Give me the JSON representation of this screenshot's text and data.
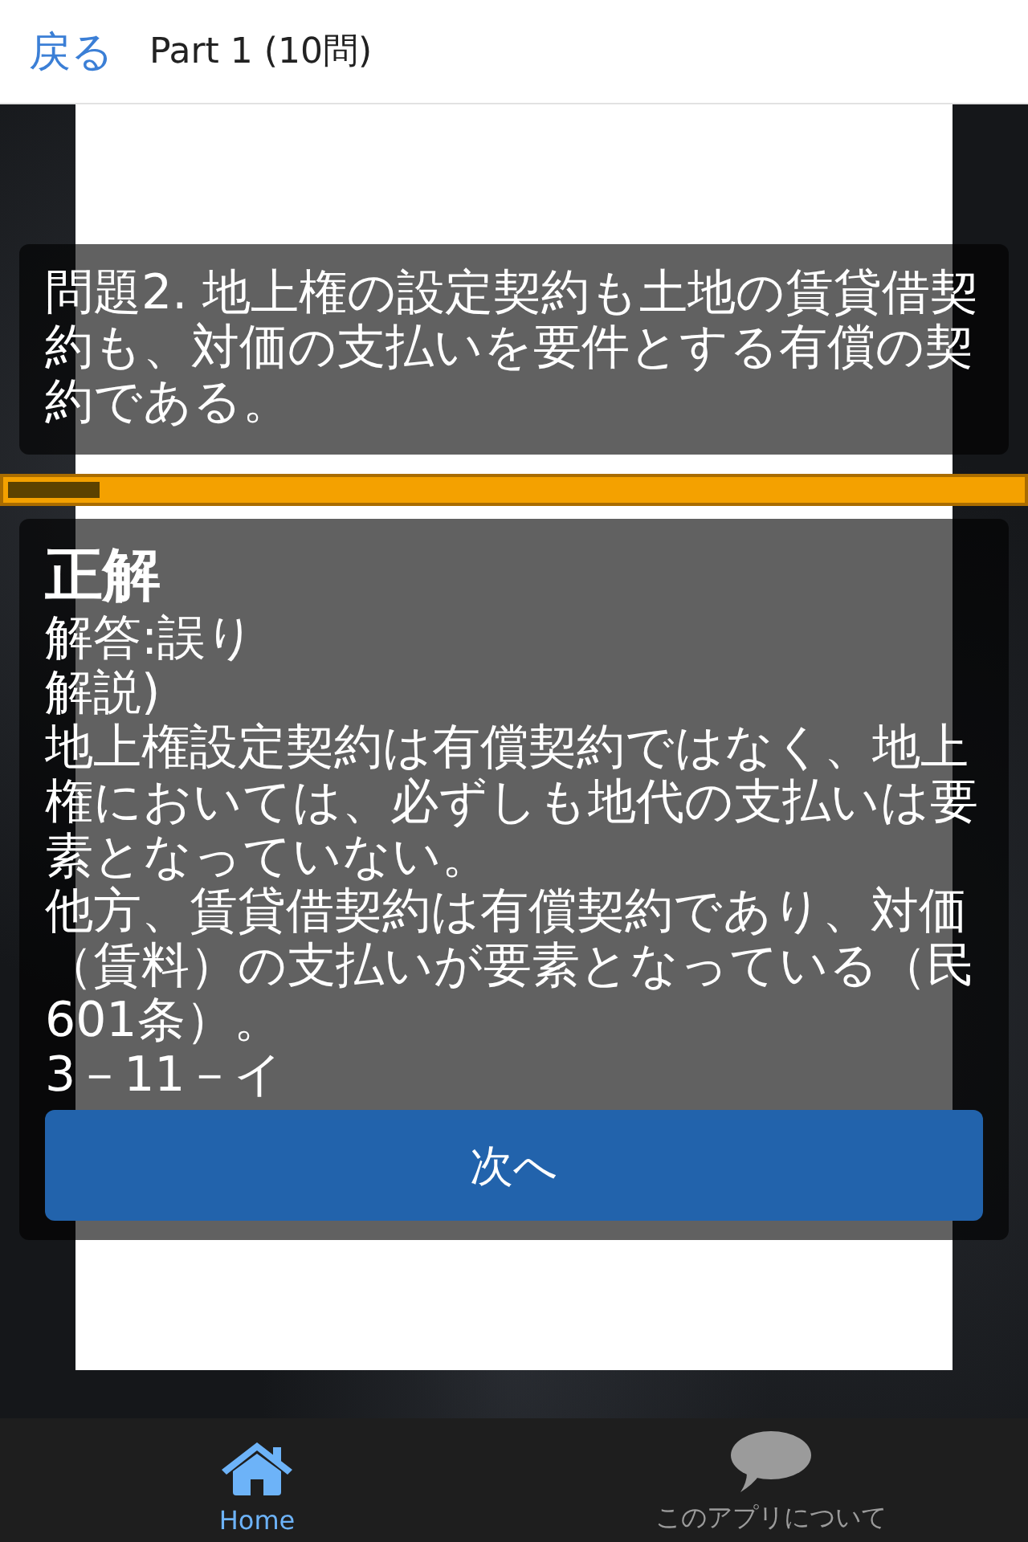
{
  "header": {
    "back_link": "戻る",
    "title": "Part 1 (10問)"
  },
  "question": {
    "text": "問題2. 地上権の設定契約も土地の賃貸借契約も、対価の支払いを要件とする有償の契約である。"
  },
  "progress": {
    "level": 0.09
  },
  "answer": {
    "verdict": "正解",
    "answer_line": "解答:誤り",
    "explanation_heading": "解説)",
    "explanation": [
      "地上権設定契約は有償契約ではなく、地上権においては、必ずしも地代の支払いは要素となっていない。",
      "他方、賃貸借契約は有償契約であり、対価（賃料）の支払いが要素となっている（民601条）。"
    ],
    "reference": "3－11－イ",
    "next_button": "次へ"
  },
  "tab_bar": {
    "tabs": [
      {
        "label": "Home",
        "kind": "home",
        "selected": true
      },
      {
        "label": "このアプリについて",
        "kind": "chat",
        "selected": false
      }
    ]
  }
}
